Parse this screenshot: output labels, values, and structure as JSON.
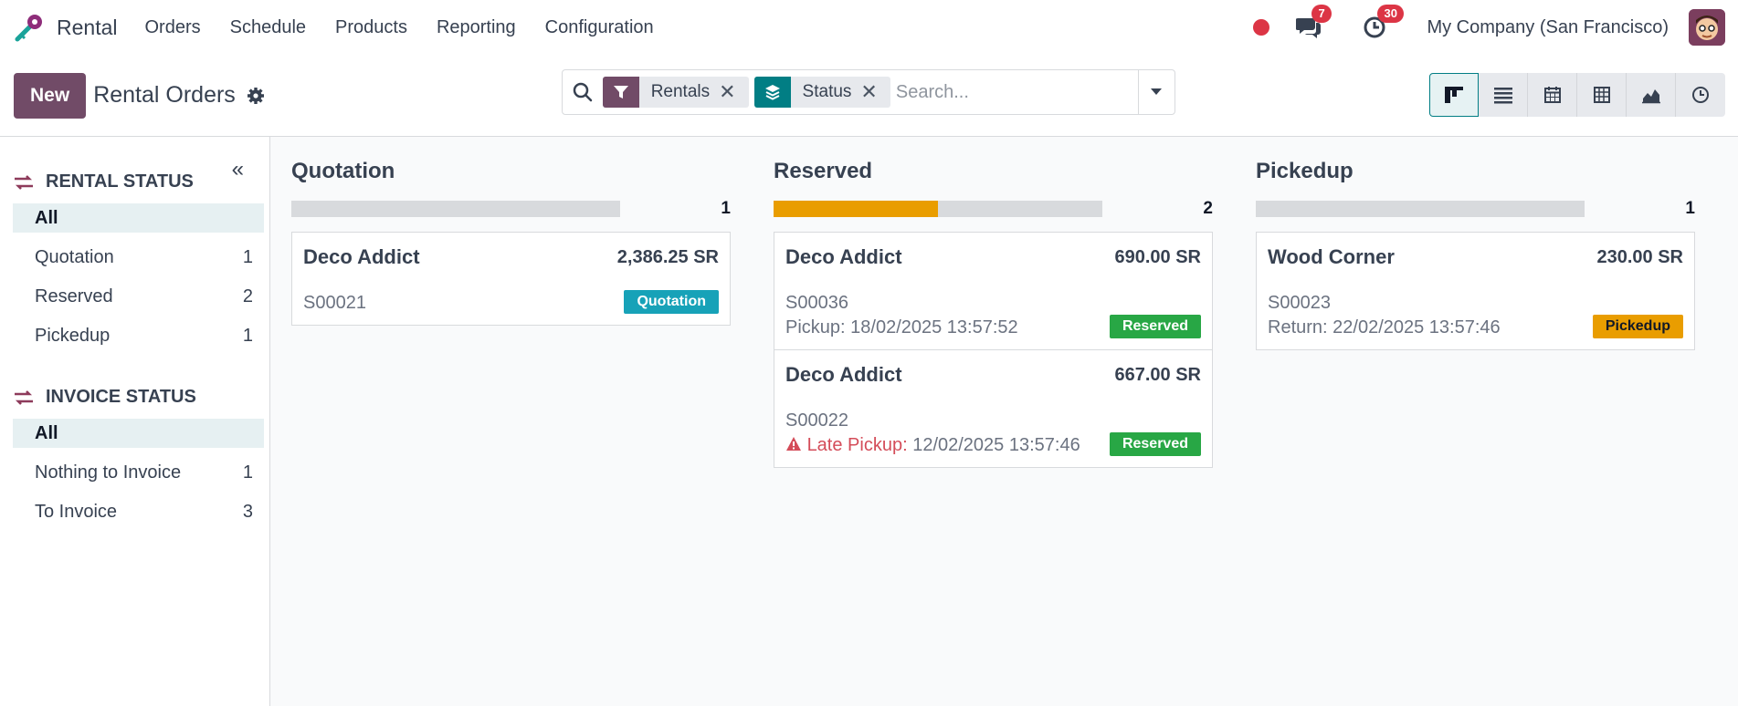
{
  "navbar": {
    "app_name": "Rental",
    "menu": [
      "Orders",
      "Schedule",
      "Products",
      "Reporting",
      "Configuration"
    ],
    "messages_count": "7",
    "activities_count": "30",
    "company": "My Company (San Francisco)"
  },
  "control": {
    "new_label": "New",
    "title": "Rental Orders",
    "facets": [
      {
        "label": "Rentals",
        "color": "#714b67"
      },
      {
        "label": "Status",
        "color": "#017e84"
      }
    ],
    "search_placeholder": "Search..."
  },
  "sidebar": {
    "rental_status": {
      "title": "RENTAL STATUS",
      "items": [
        {
          "label": "All",
          "count": ""
        },
        {
          "label": "Quotation",
          "count": "1"
        },
        {
          "label": "Reserved",
          "count": "2"
        },
        {
          "label": "Pickedup",
          "count": "1"
        }
      ]
    },
    "invoice_status": {
      "title": "INVOICE STATUS",
      "items": [
        {
          "label": "All",
          "count": ""
        },
        {
          "label": "Nothing to Invoice",
          "count": "1"
        },
        {
          "label": "To Invoice",
          "count": "3"
        }
      ]
    }
  },
  "kanban": {
    "columns": [
      {
        "title": "Quotation",
        "count": "1",
        "progress": 0,
        "cards": [
          {
            "customer": "Deco Addict",
            "amount": "2,386.25 SR",
            "ref": "S00021",
            "tag": "Quotation"
          }
        ]
      },
      {
        "title": "Reserved",
        "count": "2",
        "progress": 50,
        "cards": [
          {
            "customer": "Deco Addict",
            "amount": "690.00 SR",
            "ref": "S00036",
            "line_label": "Pickup:",
            "line_value": "18/02/2025 13:57:52",
            "tag": "Reserved"
          },
          {
            "customer": "Deco Addict",
            "amount": "667.00 SR",
            "ref": "S00022",
            "line_label": "Late Pickup:",
            "line_value": "12/02/2025 13:57:46",
            "tag": "Reserved"
          }
        ]
      },
      {
        "title": "Pickedup",
        "count": "1",
        "progress": 0,
        "cards": [
          {
            "customer": "Wood Corner",
            "amount": "230.00 SR",
            "ref": "S00023",
            "line_label": "Return:",
            "line_value": "22/02/2025 13:57:46",
            "tag": "Pickedup"
          }
        ]
      }
    ]
  },
  "colors": {
    "brand": "#714b67",
    "teal": "#017e84",
    "quotation_tag": "#17a2b8",
    "reserved_tag": "#28a745",
    "pickedup_tag": "#e99d00",
    "progress_reserved": "#e99d00",
    "danger": "#dc3545"
  }
}
